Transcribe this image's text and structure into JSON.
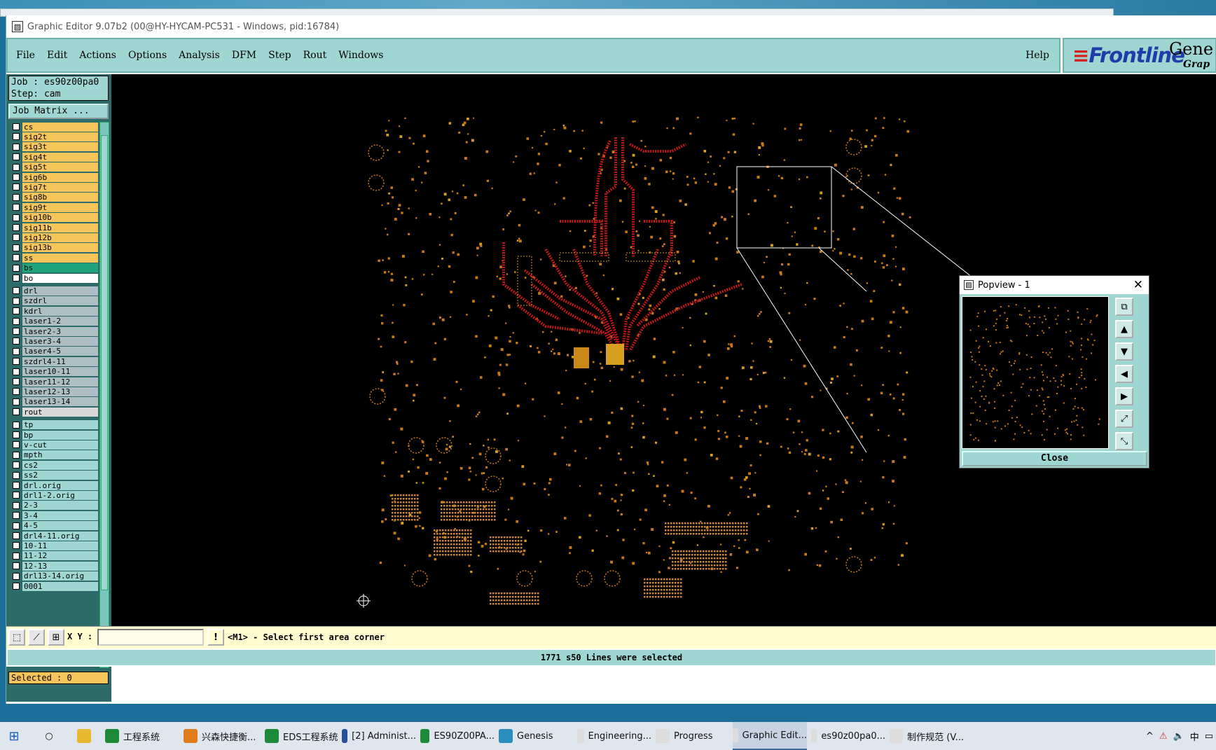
{
  "window": {
    "title": "Graphic Editor 9.07b2 (00@HY-HYCAM-PC531 - Windows, pid:16784)"
  },
  "menu": {
    "items": [
      {
        "label": "File"
      },
      {
        "label": "Edit"
      },
      {
        "label": "Actions"
      },
      {
        "label": "Options"
      },
      {
        "label": "Analysis"
      },
      {
        "label": "DFM"
      },
      {
        "label": "Step"
      },
      {
        "label": "Rout"
      },
      {
        "label": "Windows"
      }
    ],
    "help": "Help"
  },
  "brand": {
    "logo": "Frontline",
    "product_partial": "Gene",
    "sub_partial": "Grap"
  },
  "job": {
    "job_line": "Job : es90z00pa0",
    "step_line": "Step: cam",
    "matrix_button": "Job Matrix ..."
  },
  "layers": [
    {
      "name": "cs",
      "color": "#f5c55a"
    },
    {
      "name": "sig2t",
      "color": "#f5c55a"
    },
    {
      "name": "sig3t",
      "color": "#f5c55a"
    },
    {
      "name": "sig4t",
      "color": "#f5c55a"
    },
    {
      "name": "sig5t",
      "color": "#f5c55a"
    },
    {
      "name": "sig6b",
      "color": "#f5c55a"
    },
    {
      "name": "sig7t",
      "color": "#f5c55a"
    },
    {
      "name": "sig8b",
      "color": "#f5c55a"
    },
    {
      "name": "sig9t",
      "color": "#f5c55a"
    },
    {
      "name": "sig10b",
      "color": "#f5c55a"
    },
    {
      "name": "sig11b",
      "color": "#f5c55a"
    },
    {
      "name": "sig12b",
      "color": "#f5c55a"
    },
    {
      "name": "sig13b",
      "color": "#f5c55a"
    },
    {
      "name": "ss",
      "color": "#f5c55a"
    },
    {
      "name": "bs",
      "color": "#1ea37d"
    },
    {
      "name": "bo",
      "color": "#ffffff"
    },
    {
      "name": "drl",
      "color": "#aebfc4"
    },
    {
      "name": "szdrl",
      "color": "#aebfc4"
    },
    {
      "name": "kdrl",
      "color": "#aebfc4"
    },
    {
      "name": "laser1-2",
      "color": "#aebfc4"
    },
    {
      "name": "laser2-3",
      "color": "#aebfc4"
    },
    {
      "name": "laser3-4",
      "color": "#aebfc4"
    },
    {
      "name": "laser4-5",
      "color": "#aebfc4"
    },
    {
      "name": "szdrl4-11",
      "color": "#aebfc4"
    },
    {
      "name": "laser10-11",
      "color": "#aebfc4"
    },
    {
      "name": "laser11-12",
      "color": "#aebfc4"
    },
    {
      "name": "laser12-13",
      "color": "#aebfc4"
    },
    {
      "name": "laser13-14",
      "color": "#aebfc4"
    },
    {
      "name": "rout",
      "color": "#d8d8d8"
    },
    {
      "name": "tp",
      "color": "#9fd6d2"
    },
    {
      "name": "bp",
      "color": "#9fd6d2"
    },
    {
      "name": "v-cut",
      "color": "#9fd6d2"
    },
    {
      "name": "mpth",
      "color": "#9fd6d2"
    },
    {
      "name": "cs2",
      "color": "#9fd6d2"
    },
    {
      "name": "ss2",
      "color": "#9fd6d2"
    },
    {
      "name": "drl.orig",
      "color": "#9fd6d2"
    },
    {
      "name": "drl1-2.orig",
      "color": "#9fd6d2"
    },
    {
      "name": "2-3",
      "color": "#9fd6d2"
    },
    {
      "name": "3-4",
      "color": "#9fd6d2"
    },
    {
      "name": "4-5",
      "color": "#9fd6d2"
    },
    {
      "name": "drl4-11.orig",
      "color": "#9fd6d2"
    },
    {
      "name": "10-11",
      "color": "#9fd6d2"
    },
    {
      "name": "11-12",
      "color": "#9fd6d2"
    },
    {
      "name": "12-13",
      "color": "#9fd6d2"
    },
    {
      "name": "drl13-14.orig",
      "color": "#9fd6d2"
    },
    {
      "name": "0001",
      "color": "#9fd6d2"
    }
  ],
  "selected": "Selected : 0",
  "command": {
    "xy_label": "X Y :",
    "xy_value": "",
    "prompt": "<M1> - Select first area corner"
  },
  "status": "1771 s50 Lines were selected",
  "popview": {
    "title": "Popview - 1",
    "close_label": "Close"
  },
  "taskbar": {
    "items": [
      {
        "label": "工程系统"
      },
      {
        "label": "兴森快捷衡..."
      },
      {
        "label": "EDS工程系统"
      },
      {
        "label": "[2] Administ..."
      },
      {
        "label": "ES90Z00PA..."
      },
      {
        "label": "Genesis"
      },
      {
        "label": "Engineering..."
      },
      {
        "label": "Progress"
      },
      {
        "label": "Graphic Edit..."
      },
      {
        "label": "es90z00pa0..."
      },
      {
        "label": "制作规范 (V..."
      }
    ],
    "tray": {
      "ime": "中"
    }
  }
}
